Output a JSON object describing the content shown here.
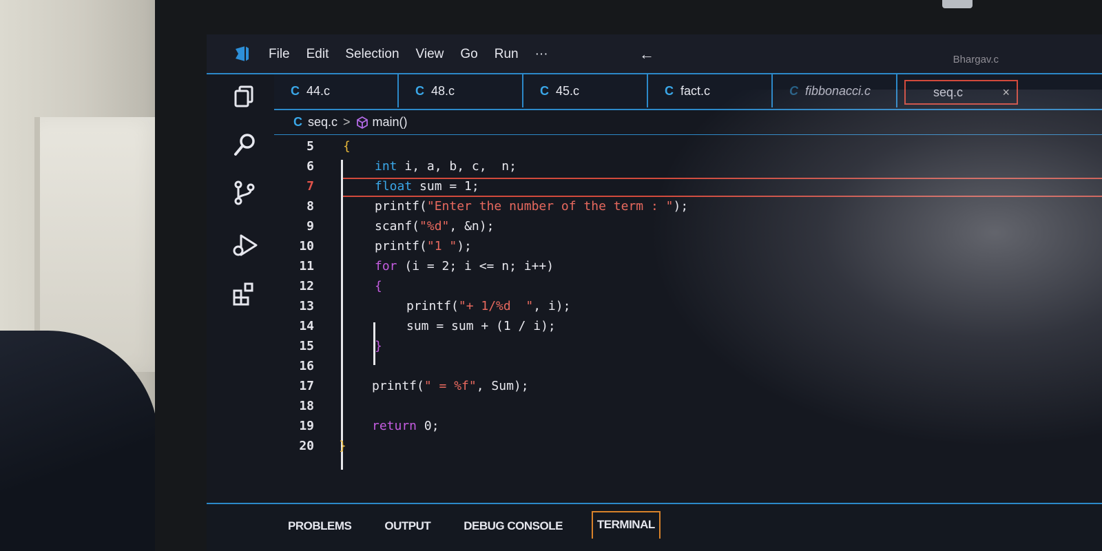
{
  "menu": {
    "items": [
      "File",
      "Edit",
      "Selection",
      "View",
      "Go",
      "Run",
      "···"
    ],
    "back_arrow": "←",
    "window_title": "Bhargav.c"
  },
  "activity_bar": {
    "icons": [
      "explorer-icon",
      "search-icon",
      "source-control-icon",
      "run-debug-icon",
      "extensions-icon"
    ]
  },
  "tabs": [
    {
      "label": "44.c",
      "icon": "C"
    },
    {
      "label": "48.c",
      "icon": "C"
    },
    {
      "label": "45.c",
      "icon": "C"
    },
    {
      "label": "fact.c",
      "icon": "C"
    },
    {
      "label": "fibbonacci.c",
      "icon": "C"
    },
    {
      "label": "seq.c",
      "close": "×",
      "active": true
    }
  ],
  "breadcrumb": {
    "file_icon": "C",
    "file": "seq.c",
    "separator": ">",
    "symbol": "main()"
  },
  "editor": {
    "current_line": 7,
    "lines": [
      {
        "num": "5",
        "code": "{"
      },
      {
        "num": "6",
        "code": "int i, a, b, c,  n;"
      },
      {
        "num": "7",
        "code": "float sum = 1;"
      },
      {
        "num": "8",
        "code": "printf(\"Enter the number of the term : \");"
      },
      {
        "num": "9",
        "code": "scanf(\"%d\", &n);"
      },
      {
        "num": "10",
        "code": "printf(\"1 \");"
      },
      {
        "num": "11",
        "code": "for (i = 2; i <= n; i++)"
      },
      {
        "num": "12",
        "code": "{"
      },
      {
        "num": "13",
        "code": "printf(\"+ 1/%d  \", i);"
      },
      {
        "num": "14",
        "code": "sum = sum + (1 / i);"
      },
      {
        "num": "15",
        "code": "}"
      },
      {
        "num": "16",
        "code": ""
      },
      {
        "num": "17",
        "code": "printf(\" = %f\", Sum);"
      },
      {
        "num": "18",
        "code": ""
      },
      {
        "num": "19",
        "code": "return 0;"
      },
      {
        "num": "20",
        "code": "}"
      }
    ]
  },
  "panel": {
    "tabs": [
      "PROBLEMS",
      "OUTPUT",
      "DEBUG CONSOLE",
      "TERMINAL"
    ],
    "active": "TERMINAL"
  },
  "colors": {
    "accent_blue": "#2c89c9",
    "active_tab_border": "#d24a3c",
    "terminal_tab_border": "#d8822a",
    "keyword": "#3aa7e8",
    "string": "#e8695e",
    "brace_outer": "#e8b93a",
    "brace_inner": "#c45ce0"
  }
}
